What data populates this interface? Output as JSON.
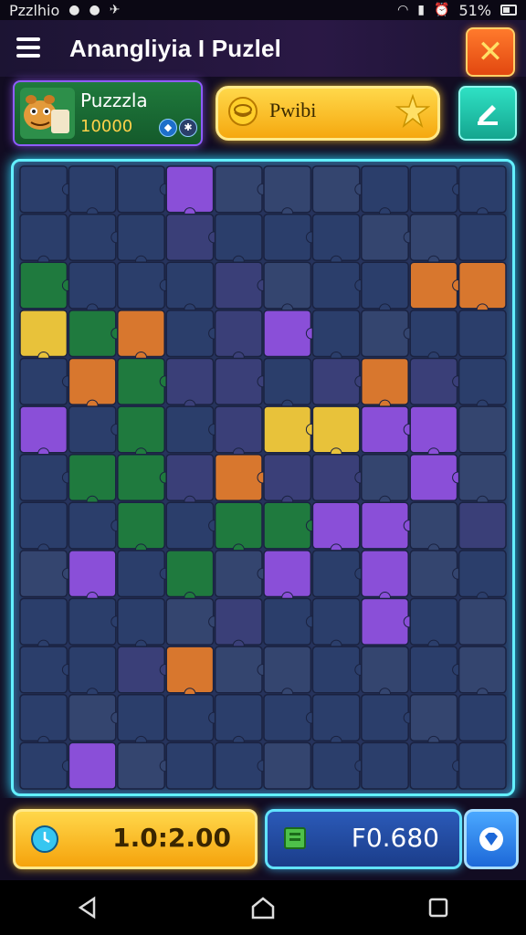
{
  "status_bar": {
    "app_name": "Pzzlhio",
    "battery": "51%",
    "icons": [
      "notification-icon",
      "chat-icon",
      "vpn-icon",
      "wifi-icon",
      "signal-icon",
      "alarm-icon",
      "battery-icon"
    ]
  },
  "header": {
    "title": "Anangliyia I Puzlel",
    "close_icon": "close-icon"
  },
  "profile": {
    "name": "Puzzzla",
    "coins": "10000"
  },
  "hint_banner": {
    "label": "Pwibi"
  },
  "bottom": {
    "timer": "1.0:2.00",
    "score": "F0.680"
  },
  "colors": {
    "board_frame": "#63f0ff",
    "gold": "#ffd84a",
    "close": "#ff6a20",
    "teal": "#2fe1c4",
    "blue_panel": "#1b3d8a"
  }
}
